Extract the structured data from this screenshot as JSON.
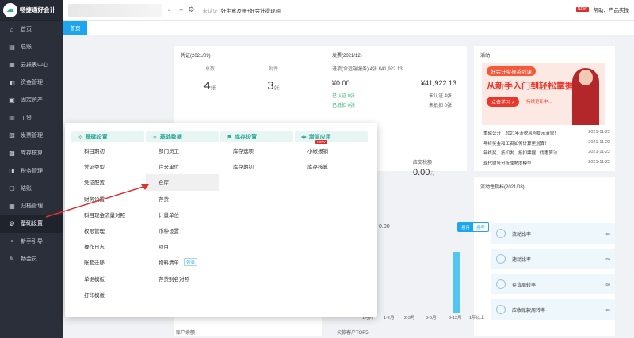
{
  "app": {
    "title": "畅捷通好会计"
  },
  "sidebar": {
    "items": [
      {
        "label": "首页",
        "icon": "home-icon"
      },
      {
        "label": "总账",
        "icon": "ledger-icon"
      },
      {
        "label": "云报表中心",
        "icon": "report-icon"
      },
      {
        "label": "资金管理",
        "icon": "fund-icon"
      },
      {
        "label": "固定资产",
        "icon": "asset-icon"
      },
      {
        "label": "工资",
        "icon": "salary-icon"
      },
      {
        "label": "发票管理",
        "icon": "invoice-icon"
      },
      {
        "label": "库存核算",
        "icon": "stock-icon"
      },
      {
        "label": "税务管理",
        "icon": "tax-icon"
      },
      {
        "label": "结账",
        "icon": "close-icon"
      },
      {
        "label": "归档管理",
        "icon": "archive-icon"
      },
      {
        "label": "基础设置",
        "icon": "gear-icon"
      },
      {
        "label": "新手引导",
        "icon": "guide-icon"
      },
      {
        "label": "畅会员",
        "icon": "member-icon"
      }
    ]
  },
  "topbar": {
    "auth": "未认证",
    "note": "好生意及账+好会计提现粗",
    "right_new": "NEW",
    "right_text": "帮助、产品实操"
  },
  "tab": {
    "label": "首页"
  },
  "voucher": {
    "title": "凭证(2021/09)",
    "total_label": "总数",
    "total": "4",
    "attach_label": "附件",
    "attach": "3",
    "unit": "张"
  },
  "invoice": {
    "title": "发票(2021/12)",
    "subtitle": "进项(含远端服务) 4张 ¥41,922.13",
    "left_amt": "¥0.00",
    "right_amt": "¥41,922.13",
    "r1l": "已认证  0张",
    "r1r": "未认证  4张",
    "r2l": "已抵扣  0张",
    "r2r": "未抵扣  0张"
  },
  "receivable": {
    "label": "应交税额",
    "amount": "0.00",
    "unit": "元"
  },
  "activity": {
    "title": "活动",
    "banner_tag": "好会计实操系列课",
    "banner_title": "从新手入门到轻松掌握",
    "banner_btn": "点击学习 >",
    "banner_note": "持续更新中…",
    "news": [
      {
        "text": "重磅公开！2021年涉税风险提示清单！",
        "date": "2021-11-22"
      },
      {
        "text": "年终奖金和工资如何计算更划算？",
        "date": "2021-11-22"
      },
      {
        "text": "年终奖、抵扣发、抵扣票据、优惠算法…",
        "date": "2021-11-22"
      },
      {
        "text": "现代财务分析成熟度模型",
        "date": "2021-11-22"
      }
    ]
  },
  "chart": {
    "amount": "0.00",
    "toggle_month": "按月",
    "toggle_year": "按年",
    "x": [
      "1月内",
      "1-2月",
      "2-3月",
      "3-6月",
      "6-12月",
      "1年以上"
    ]
  },
  "liquidity": {
    "title": "流动性指标(2021/08)",
    "items": [
      {
        "label": "流动比率",
        "value": "∞"
      },
      {
        "label": "速动比率",
        "value": "∞"
      },
      {
        "label": "存货周转率",
        "value": "∞"
      },
      {
        "label": "应收账款周转率",
        "value": "∞"
      }
    ]
  },
  "bottom": {
    "left": "账户余额",
    "mid": "欠款客户TOP5"
  },
  "menu": {
    "columns": [
      {
        "title": "基础设置",
        "icon": "settings-icon",
        "items": [
          "科目期初",
          "凭证类型",
          "凭证配置",
          "财务设置",
          "科目现金流量对照",
          "权限管理",
          "操作日志",
          "账套迁移",
          "单据模板",
          "打印模板"
        ]
      },
      {
        "title": "基础数据",
        "icon": "data-icon",
        "items": [
          "部门员工",
          "往来单位",
          "仓库",
          "存货",
          "计量单位",
          "币种设置",
          "项目",
          "物料清单",
          "存货别名对照"
        ],
        "tag_item": "物料清单",
        "tag": "列表",
        "hl_item": "仓库"
      },
      {
        "title": "库存设置",
        "icon": "inventory-icon",
        "items": [
          "库存选项",
          "库存期初"
        ]
      },
      {
        "title": "增值应用",
        "icon": "addon-icon",
        "items": [
          "小帐报销",
          "库存核算"
        ],
        "new_item": "小帐报销",
        "new": "NEW"
      }
    ]
  }
}
